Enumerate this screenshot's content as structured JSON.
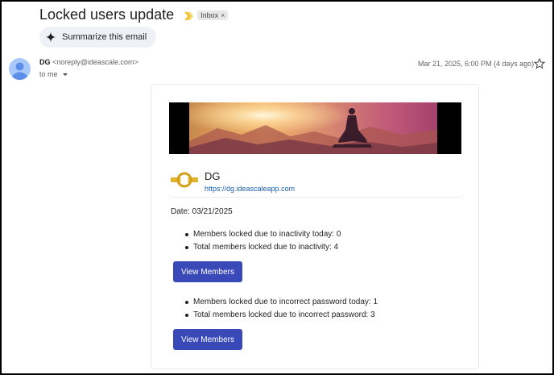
{
  "email": {
    "subject": "Locked users update",
    "label": "Inbox",
    "label_close": "×",
    "summarize_label": "Summarize this email",
    "sender_name": "DG",
    "sender_email": "<noreply@ideascale.com>",
    "to_label": "to me",
    "date": "Mar 21, 2025, 6:00 PM (4 days ago)"
  },
  "body": {
    "org_name": "DG",
    "org_link": "https://dg.ideascaleapp.com",
    "date_line": "Date: 03/21/2025",
    "inactivity": {
      "items": [
        "Members locked due to inactivity today: 0",
        "Total members locked due to inactivity: 4"
      ],
      "button_label": "View Members"
    },
    "password": {
      "items": [
        "Members locked due to incorrect password today: 1",
        "Total members locked due to incorrect password: 3"
      ],
      "button_label": "View Members"
    }
  },
  "icons": {
    "importance": "importance-marker-icon",
    "sparkle": "sparkle-icon",
    "star": "star-icon",
    "avatar": "person-avatar-icon",
    "logo": "gold-ring-logo"
  },
  "colors": {
    "accent_button": "#3949b8",
    "link": "#1a5fb4",
    "importance": "#f2c53d",
    "avatar": "#a8c7fa"
  }
}
